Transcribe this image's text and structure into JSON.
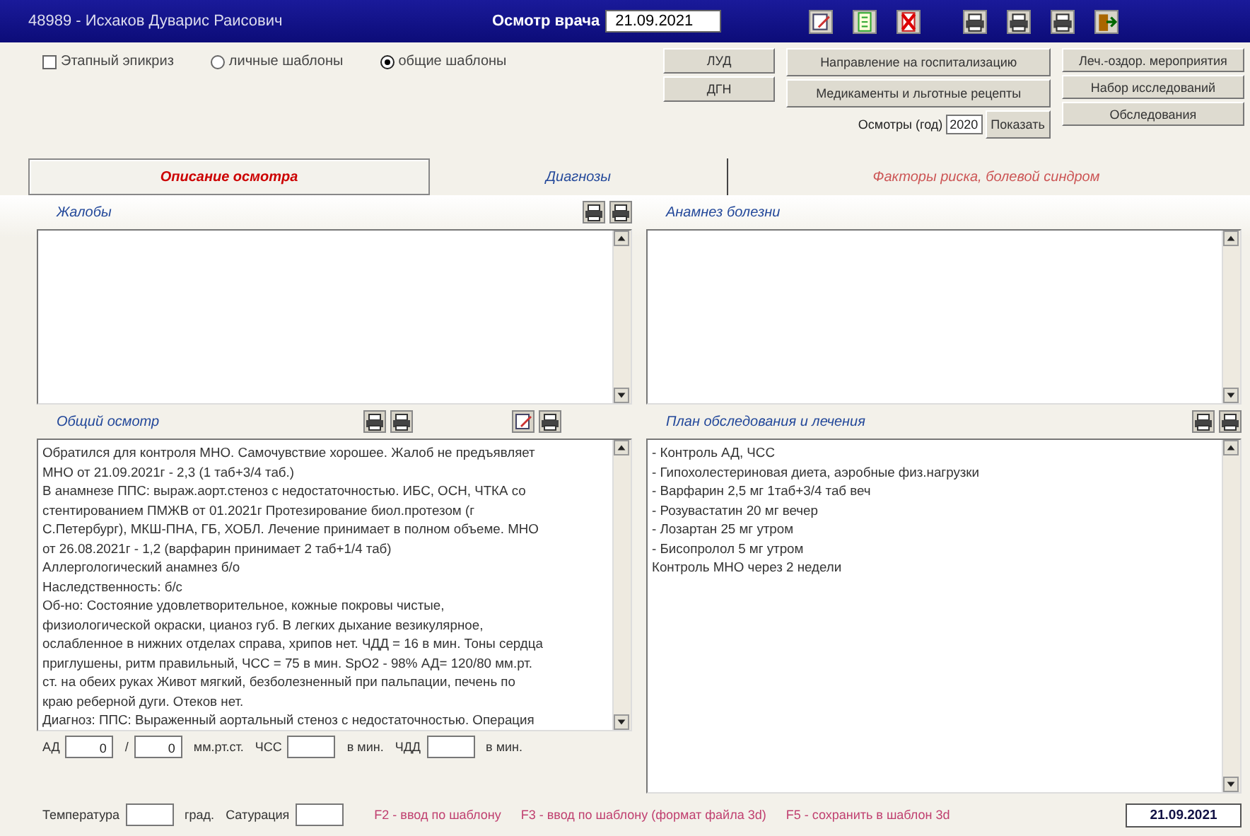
{
  "window": {
    "title": "48989 - Исхаков Дуварис Раисович",
    "exam_label": "Осмотр врача",
    "exam_date": "21.09.2021"
  },
  "toolbar": [
    {
      "kind": "edit"
    },
    {
      "kind": "document"
    },
    {
      "kind": "delete"
    },
    {
      "kind": "print"
    },
    {
      "kind": "print"
    },
    {
      "kind": "print"
    },
    {
      "kind": "exit"
    }
  ],
  "staged_epicrisis": {
    "label": "Этапный эпикриз",
    "checked": false
  },
  "templates": [
    {
      "label": "личные шаблоны",
      "selected": false
    },
    {
      "label": "общие шаблоны",
      "selected": true
    }
  ],
  "short_buttons": [
    "ЛУД",
    "ДГН"
  ],
  "action_buttons": [
    "Направление на госпитализацию",
    "Медикаменты и льготные рецепты"
  ],
  "exams_year": {
    "label": "Осмотры (год)",
    "value": "2020",
    "button": "Показать"
  },
  "side_buttons": [
    "Леч.-оздор. мероприятия",
    "Набор исследований",
    "Обследования"
  ],
  "tabs": [
    {
      "label": "Описание осмотра",
      "selected": true
    },
    {
      "label": "Диагнозы",
      "selected": false
    },
    {
      "label": "Факторы риска, болевой синдром",
      "selected": false
    }
  ],
  "sections": [
    {
      "title": "Жалобы",
      "tools": [
        {
          "kind": "print"
        },
        {
          "kind": "print"
        }
      ]
    },
    {
      "title": "Анамнез болезни"
    },
    {
      "title": "Общий осмотр",
      "tools": [
        {
          "kind": "print"
        },
        {
          "kind": "print"
        }
      ],
      "extra_tools": [
        {
          "kind": "edit"
        },
        {
          "kind": "print"
        }
      ],
      "lines": [
        "Обратился для контроля МНО. Самочувствие хорошее. Жалоб не предъявляет",
        "МНО от 21.09.2021г - 2,3 (1 таб+3/4 таб.)",
        "В анамнезе ППС: выраж.аорт.стеноз с недостаточностью. ИБС, ОСН, ЧТКА со",
        "стентированием ПМЖВ от 01.2021г Протезирование биол.протезом (г",
        "С.Петербург), МКШ-ПНА, ГБ, ХОБЛ. Лечение принимает в полном объеме. МНО",
        "от 26.08.2021г - 1,2 (варфарин принимает 2 таб+1/4 таб)",
        "Аллергологический анамнез б/о",
        "Наследственность: б/с",
        "Об-но: Состояние удовлетворительное, кожные покровы чистые,",
        "физиологической окраски, цианоз губ. В легких дыхание везикулярное,",
        "ослабленное в нижних отделах справа, хрипов нет. ЧДД = 16 в мин. Тоны сердца",
        "приглушены, ритм правильный, ЧСС = 75 в мин. SpO2 - 98% АД= 120/80 мм.рт.",
        "ст. на обеих руках Живот мягкий, безболезненный при пальпации, печень по",
        "краю реберной дуги. Отеков нет.",
        "Диагноз: ППС: Выраженный аортальный стеноз с недостаточностью. Операция"
      ]
    },
    {
      "title": "План обследования и лечения",
      "tools": [
        {
          "kind": "print"
        },
        {
          "kind": "print"
        }
      ],
      "lines": [
        "- Контроль АД, ЧСС",
        "- Гипохолестериновая диета, аэробные физ.нагрузки",
        "- Варфарин 2,5 мг 1таб+3/4 таб веч",
        "- Розувастатин 20 мг вечер",
        "- Лозартан 25 мг утром",
        "- Бисопролол 5 мг утром",
        "Контроль МНО через 2 недели"
      ]
    }
  ],
  "vitals_row_1": [
    {
      "kind": "label",
      "text": "АД"
    },
    {
      "kind": "field",
      "value": "0"
    },
    {
      "kind": "label",
      "text": "/"
    },
    {
      "kind": "field",
      "value": "0"
    },
    {
      "kind": "label",
      "text": "мм.рт.ст."
    },
    {
      "kind": "label",
      "text": "ЧСС"
    },
    {
      "kind": "field"
    },
    {
      "kind": "label",
      "text": "в мин."
    },
    {
      "kind": "label",
      "text": "ЧДД"
    },
    {
      "kind": "field"
    },
    {
      "kind": "label",
      "text": "в мин."
    }
  ],
  "vitals_row_2": [
    {
      "kind": "label",
      "text": "Температура"
    },
    {
      "kind": "field"
    },
    {
      "kind": "label",
      "text": "град."
    },
    {
      "kind": "label",
      "text": "Сатурация"
    },
    {
      "kind": "field"
    }
  ],
  "hints": [
    "F2 - ввод по шаблону",
    "F3 - ввод по шаблону (формат файла 3d)",
    "F5 - сохранить в шаблон 3d"
  ],
  "status_date": "21.09.2021"
}
